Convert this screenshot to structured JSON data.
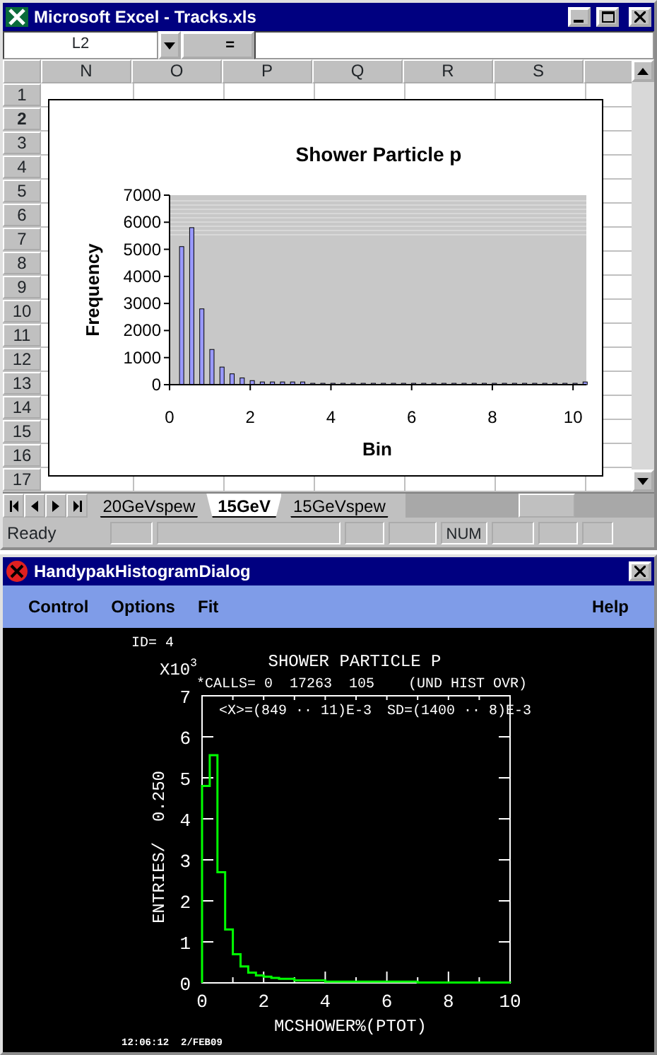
{
  "excel": {
    "window": {
      "title": "Microsoft Excel - Tracks.xls"
    },
    "formula_bar": {
      "name_box": "L2",
      "equals": "="
    },
    "columns": [
      "N",
      "O",
      "P",
      "Q",
      "R",
      "S"
    ],
    "rows": [
      {
        "label": "1",
        "selected": false
      },
      {
        "label": "2",
        "selected": true
      },
      {
        "label": "3",
        "selected": false
      },
      {
        "label": "4",
        "selected": false
      },
      {
        "label": "5",
        "selected": false
      },
      {
        "label": "6",
        "selected": false
      },
      {
        "label": "7",
        "selected": false
      },
      {
        "label": "8",
        "selected": false
      },
      {
        "label": "9",
        "selected": false
      },
      {
        "label": "10",
        "selected": false
      },
      {
        "label": "11",
        "selected": false
      },
      {
        "label": "12",
        "selected": false
      },
      {
        "label": "13",
        "selected": false
      },
      {
        "label": "14",
        "selected": false
      },
      {
        "label": "15",
        "selected": false
      },
      {
        "label": "16",
        "selected": false
      },
      {
        "label": "17",
        "selected": false
      }
    ],
    "chart": {
      "chart_data": {
        "type": "bar",
        "title": "Shower Particle p",
        "xlabel": "Bin",
        "ylabel": "Frequency",
        "x": [
          0.3,
          0.55,
          0.8,
          1.05,
          1.3,
          1.55,
          1.8,
          2.05,
          2.3,
          2.55,
          2.8,
          3.05,
          3.3,
          3.55,
          3.8,
          4.05,
          4.3,
          4.55,
          4.8,
          5.05,
          5.3,
          5.55,
          5.8,
          6.05,
          6.3,
          6.55,
          6.8,
          7.05,
          7.3,
          7.55,
          7.8,
          8.05,
          8.3,
          8.55,
          8.8,
          9.05,
          9.3,
          9.55,
          9.8,
          10.05,
          10.3
        ],
        "values": [
          5100,
          5800,
          2800,
          1300,
          650,
          400,
          250,
          150,
          100,
          100,
          100,
          100,
          100,
          50,
          50,
          50,
          50,
          50,
          50,
          50,
          50,
          50,
          50,
          50,
          50,
          50,
          50,
          50,
          50,
          50,
          50,
          50,
          50,
          50,
          50,
          50,
          50,
          50,
          50,
          50,
          100
        ],
        "xlim": [
          0,
          10.33
        ],
        "ylim": [
          0,
          7000
        ],
        "xticks": [
          0,
          2,
          4,
          6,
          8,
          10
        ],
        "yticks": [
          0,
          1000,
          2000,
          3000,
          4000,
          5000,
          6000,
          7000
        ]
      }
    },
    "sheet_tabs": [
      {
        "label": "20GeVspew",
        "selected": false
      },
      {
        "label": "15GeV",
        "selected": true
      },
      {
        "label": "15GeVspew",
        "selected": false
      }
    ],
    "status_bar": {
      "status": "Ready",
      "indicators": [
        "NUM"
      ]
    }
  },
  "dialog": {
    "window": {
      "title": "HandypakHistogramDialog"
    },
    "menu": [
      "Control",
      "Options",
      "Fit"
    ],
    "help_menu": "Help",
    "plot": {
      "id_line": "ID=   4",
      "scale_base": "X10",
      "scale_exponent": "3",
      "stats_line": "*CALLS= 0  17263  105    (UND HIST OVR)",
      "mean": "<X>=(849 ·· 11)E-3",
      "sd": "SD=(1400 ·· 8)E-3",
      "footer": "12:06:12  2/FEB09",
      "chart_data": {
        "type": "line",
        "title": "SHOWER PARTICLE P",
        "xlabel": "MCSHOWER%(PTOT)",
        "ylabel": "ENTRIES/  0.250",
        "x": [
          0,
          0,
          0.25,
          0.25,
          0.5,
          0.5,
          0.75,
          0.75,
          1,
          1,
          1.25,
          1.25,
          1.5,
          1.5,
          1.75,
          1.75,
          2,
          2,
          2.25,
          2.25,
          2.5,
          2.5,
          3,
          3,
          4,
          4,
          7,
          7,
          10,
          10
        ],
        "series": [
          {
            "color": "#00ff00",
            "values": [
              0,
              4.8,
              4.8,
              5.55,
              5.55,
              2.7,
              2.7,
              1.3,
              1.3,
              0.7,
              0.7,
              0.4,
              0.4,
              0.25,
              0.25,
              0.18,
              0.18,
              0.15,
              0.15,
              0.12,
              0.12,
              0.1,
              0.1,
              0.06,
              0.06,
              0.03,
              0.03,
              0.01,
              0.01,
              0
            ]
          }
        ],
        "xlim": [
          0,
          10
        ],
        "ylim": [
          0,
          7
        ],
        "xticks": [
          0,
          2,
          4,
          6,
          8,
          10
        ],
        "yticks": [
          0,
          1,
          2,
          3,
          4,
          5,
          6,
          7
        ]
      }
    }
  }
}
